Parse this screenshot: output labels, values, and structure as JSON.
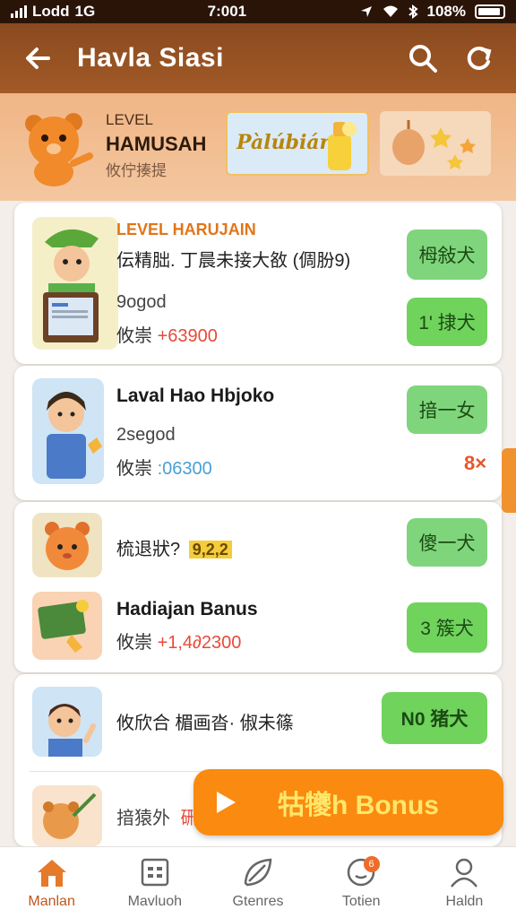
{
  "status_bar": {
    "carrier": "Lodd",
    "network": "1G",
    "time": "7:001",
    "battery": "108%"
  },
  "app_bar": {
    "title": "Havla Siasi"
  },
  "header": {
    "level_label": "LEVEL",
    "name": "HAMUSAH",
    "subtitle": "攸佇揍提",
    "banner_text": "Pàlúbiár"
  },
  "cards": [
    {
      "level": "LEVEL HARUJAIN",
      "desc": "伝精朏. 丁晨未接大敋 (倜朌9)",
      "sub": "9ogod",
      "price_prefix": "攸崇",
      "price": "+63900",
      "btn1": "栂敍犬",
      "btn2": "1' 捸犬"
    },
    {
      "name": "Laval Hao Hbjoko",
      "sub": "2segod",
      "price_prefix": "攸崇",
      "price": ":06300",
      "btn": "揞一女",
      "mark": "8×"
    },
    {
      "desc": "梳退狀?",
      "stars": "9,2,2",
      "btn1": "傻一犬",
      "name": "Hadiajan Banus",
      "price_prefix": "攸崇",
      "price": "+1,4∂2300",
      "btn2": "3 簇犬"
    },
    {
      "desc": "攸欣合 楣画沓· 俶未篠",
      "btn": "N0 猪犬",
      "sub": "揞猿外",
      "sub2": "硎"
    }
  ],
  "bonus_button": {
    "label": "牯犪h Bonus"
  },
  "bottom_nav": [
    {
      "label": "Manlan",
      "icon": "home-icon",
      "active": true
    },
    {
      "label": "Mavluoh",
      "icon": "calendar-icon",
      "active": false
    },
    {
      "label": "Gtenres",
      "icon": "leaf-icon",
      "active": false
    },
    {
      "label": "Totien",
      "icon": "chat-icon",
      "active": false,
      "badge": "6"
    },
    {
      "label": "Haldn",
      "icon": "person-icon",
      "active": false
    }
  ],
  "colors": {
    "brand_brown": "#8a4a1f",
    "accent_orange": "#fa8a10",
    "button_green": "#6fd35c"
  }
}
